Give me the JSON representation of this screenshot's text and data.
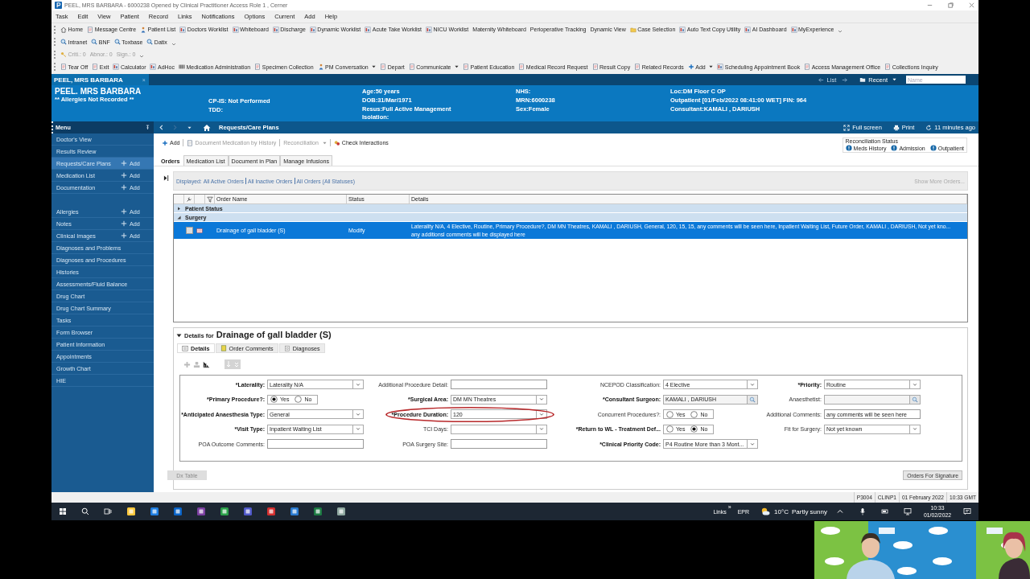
{
  "window": {
    "title": "PEEL, MRS BARBARA - 6000238 Opened by Clinical Practitioner Access Role 1 , Cerner"
  },
  "menu_bar": [
    "Task",
    "Edit",
    "View",
    "Patient",
    "Record",
    "Links",
    "Notifications",
    "Options",
    "Current",
    "Add",
    "Help"
  ],
  "toolbars": [
    {
      "overflow": true,
      "items": [
        {
          "label": "Home"
        },
        {
          "label": "Message Centre"
        },
        {
          "label": "Patient List"
        },
        {
          "label": "Doctors Worklist"
        },
        {
          "label": "Whiteboard"
        },
        {
          "label": "Discharge"
        },
        {
          "label": "Dynamic Worklist"
        },
        {
          "label": "Acute Take Worklist"
        },
        {
          "label": "NICU Worklist"
        },
        {
          "label": "Maternity Whiteboard"
        },
        {
          "label": "Perioperative Tracking"
        },
        {
          "label": "Dynamic View"
        },
        {
          "label": "Case Selection"
        },
        {
          "label": "Auto Text Copy Utility"
        },
        {
          "label": "AI Dashboard"
        },
        {
          "label": "MyExperience"
        }
      ]
    },
    {
      "overflow": true,
      "items": [
        {
          "label": "Intranet"
        },
        {
          "label": "BNF"
        },
        {
          "label": "Toxbase"
        },
        {
          "label": "Datix"
        }
      ]
    },
    {
      "overflow": true,
      "items": [
        {
          "label": "Criti.: 0",
          "disabled": true
        },
        {
          "label": "Abnor.: 0",
          "disabled": true
        },
        {
          "label": "Sign.: 0",
          "disabled": true
        }
      ]
    },
    {
      "overflow": false,
      "items": [
        {
          "label": "Tear Off",
          "dropdown": false
        },
        {
          "label": "Exit",
          "dropdown": false
        },
        {
          "label": "Calculator",
          "dropdown": false
        },
        {
          "label": "AdHoc",
          "dropdown": false
        },
        {
          "label": "Medication Administration",
          "dropdown": false
        },
        {
          "label": "Specimen Collection",
          "dropdown": false
        },
        {
          "label": "PM Conversation",
          "dropdown": true
        },
        {
          "label": "Depart",
          "dropdown": false
        },
        {
          "label": "Communicate",
          "dropdown": true
        },
        {
          "label": "Patient Education",
          "dropdown": false
        },
        {
          "label": "Medical Record Request",
          "dropdown": false
        },
        {
          "label": "Result Copy",
          "dropdown": false
        },
        {
          "label": "Related Records",
          "dropdown": false
        },
        {
          "label": "Add",
          "dropdown": true
        },
        {
          "label": "Scheduling Appointment Book",
          "dropdown": false
        },
        {
          "label": "Access Management Office",
          "dropdown": false
        },
        {
          "label": "Collections Inquiry",
          "dropdown": false
        }
      ]
    }
  ],
  "patient_tab": {
    "label": "PEEL, MRS BARBARA",
    "close": "×"
  },
  "nav": {
    "list": "List",
    "recent": "Recent",
    "search": {
      "placeholder": "Name"
    }
  },
  "banner": {
    "name": "PEEL. MRS BARBARA",
    "allergies": "** Allergies Not Recorded **",
    "columns": [
      [
        "CP-IS: Not Performed",
        "TDD:"
      ],
      [
        "Age:50 years",
        "DOB:31/Mar/1971",
        "Resus:Full Active Management",
        "Isolation:"
      ],
      [
        "NHS:",
        "MRN:6000238",
        "Sex:Female"
      ],
      [
        "Loc:DM Floor C OP",
        "Outpatient [01/Feb/2022 08:41:00 WET] FIN: 964",
        "Consultant:KAMALI , DARIUSH"
      ]
    ]
  },
  "sidebar": {
    "title": "Menu",
    "groups": [
      [
        {
          "label": "Doctor's View",
          "selected": false
        },
        {
          "label": "Results Review",
          "selected": false
        },
        {
          "label": "Requests/Care Plans",
          "add": "Add",
          "selected": true
        },
        {
          "label": "Medication List",
          "add": "Add",
          "selected": false
        },
        {
          "label": "Documentation",
          "add": "Add",
          "selected": false
        }
      ],
      [
        {
          "label": "Allergies",
          "add": "Add",
          "selected": false
        },
        {
          "label": "Notes",
          "add": "Add",
          "selected": false
        },
        {
          "label": "Clinical Images",
          "add": "Add",
          "selected": false
        },
        {
          "label": "Diagnoses and Problems",
          "selected": false
        },
        {
          "label": "Diagnoses and Procedures",
          "selected": false
        },
        {
          "label": "Histories",
          "selected": false
        },
        {
          "label": "Assessments/Fluid Balance",
          "selected": false
        },
        {
          "label": "Drug Chart",
          "selected": false
        },
        {
          "label": "Drug Chart Summary",
          "selected": false
        },
        {
          "label": "Tasks",
          "selected": false
        },
        {
          "label": "Form Browser",
          "selected": false
        },
        {
          "label": "Patient Information",
          "selected": false
        },
        {
          "label": "Appointments",
          "selected": false
        },
        {
          "label": "Growth Chart",
          "selected": false
        },
        {
          "label": "HIE",
          "selected": false
        }
      ]
    ]
  },
  "page_header": {
    "title": "Requests/Care Plans",
    "full_screen": "Full screen",
    "print": "Print",
    "refreshed": "11 minutes ago"
  },
  "actions": [
    {
      "label": "Add",
      "disabled": false,
      "dropdown": false
    },
    {
      "label": "Document Medication by History",
      "disabled": true,
      "dropdown": false
    },
    {
      "label": "Reconciliation",
      "disabled": true,
      "dropdown": true
    },
    {
      "label": "Check Interactions",
      "disabled": false,
      "dropdown": false
    }
  ],
  "reconciliation": {
    "title": "Reconciliation Status",
    "items": [
      "Meds History",
      "Admission",
      "Outpatient"
    ]
  },
  "tabs": [
    {
      "label": "Orders",
      "selected": true
    },
    {
      "label": "Medication List",
      "selected": false
    },
    {
      "label": "Document in Plan",
      "selected": false
    },
    {
      "label": "Manage Infusions",
      "selected": false
    }
  ],
  "filter": {
    "prefix": "Displayed:",
    "links": [
      "All Active Orders",
      "All Inactive Orders",
      "All Orders (All Statuses)"
    ],
    "show_more": "Show More Orders..."
  },
  "table": {
    "columns": [
      "Order Name",
      "Status",
      "Details"
    ],
    "groups": [
      {
        "label": "Patient Status",
        "expanded": false
      },
      {
        "label": "Surgery",
        "expanded": true,
        "rows": [
          {
            "name": "Drainage of gall bladder (S)",
            "status": "Modify",
            "details": [
              "Laterality N/A, 4 Elective, Routine, Primary Procedure?, DM MN Theatres, KAMALI , DARIUSH, General, 120, 15, 15, any comments will be seen here, Inpatient Waiting List, Future Order, KAMALI , DARIUSH, Not yet kno...",
              "any additionsl comments will be displayed here"
            ],
            "selected": true
          }
        ]
      }
    ]
  },
  "details": {
    "prefix": "Details for",
    "title": "Drainage of gall bladder (S)",
    "tabs": [
      {
        "label": "Details",
        "selected": true
      },
      {
        "label": "Order Comments",
        "selected": false
      },
      {
        "label": "Diagnoses",
        "selected": false
      }
    ],
    "rows": [
      [
        {
          "label": "*Laterality:",
          "required": true,
          "kind": "dropdown",
          "value": "Laterality N/A"
        },
        {
          "label": "Additional Procedure Detail:",
          "required": false,
          "kind": "text"
        },
        {
          "label": "NCEPOD Classification:",
          "required": false,
          "kind": "dropdown",
          "value": "4 Elective"
        },
        {
          "label": "*Priority:",
          "required": true,
          "kind": "dropdown",
          "value": "Routine"
        }
      ],
      [
        {
          "label": "*Primary Procedure?:",
          "required": true,
          "kind": "radio",
          "options": [
            {
              "label": "Yes",
              "selected": true
            },
            {
              "label": "No",
              "selected": false
            }
          ]
        },
        {
          "label": "*Surgical Area:",
          "required": true,
          "kind": "dropdown",
          "value": "DM MN Theatres"
        },
        {
          "label": "*Consultant Surgeon:",
          "required": true,
          "kind": "lookup",
          "value": "KAMALI , DARIUSH"
        },
        {
          "label": "Anaesthetist:",
          "required": false,
          "kind": "lookup"
        }
      ],
      [
        {
          "label": "*Anticipated Anaesthesia Type:",
          "required": true,
          "kind": "dropdown",
          "value": "General"
        },
        {
          "label": "*Procedure Duration:",
          "required": true,
          "kind": "dropdown",
          "value": "120",
          "circled": true
        },
        {
          "label": "Concurrent Procedures?:",
          "required": false,
          "kind": "radio",
          "options": [
            {
              "label": "Yes",
              "selected": false
            },
            {
              "label": "No",
              "selected": false
            }
          ]
        },
        {
          "label": "Additional Comments:",
          "required": false,
          "kind": "text",
          "value": "any comments will be seen here"
        }
      ],
      [
        {
          "label": "*Visit Type:",
          "required": true,
          "kind": "dropdown",
          "value": "Inpatient Waiting List"
        },
        {
          "label": "TCI Days:",
          "required": false,
          "kind": "dropdown"
        },
        {
          "label": "*Return to WL - Treatment Def...",
          "required": true,
          "kind": "radio",
          "options": [
            {
              "label": "Yes",
              "selected": false
            },
            {
              "label": "No",
              "selected": true
            }
          ]
        },
        {
          "label": "Fit for Surgery:",
          "required": false,
          "kind": "dropdown",
          "value": "Not yet known"
        }
      ],
      [
        {
          "label": "POA Outcome Comments:",
          "required": false,
          "kind": "text"
        },
        {
          "label": "POA Surgery Site:",
          "required": false,
          "kind": "text"
        },
        {
          "label": "*Clinical Priority Code:",
          "required": true,
          "kind": "dropdown",
          "value": "P4 Routine More than 3 Mont..."
        }
      ]
    ]
  },
  "buttons": [
    {
      "label": "Dx Table",
      "disabled": true
    },
    {
      "label": "Orders For Signature",
      "disabled": false
    }
  ],
  "status_bar": [
    "P3004",
    "CLINP1",
    "01 February 2022",
    "10:33 GMT"
  ],
  "taskbar": {
    "links": "Links",
    "chevron": "»",
    "epr": "EPR",
    "temperature": "10°C",
    "weather": "Partly sunny",
    "time": "10:33",
    "date": "01/02/2022"
  }
}
